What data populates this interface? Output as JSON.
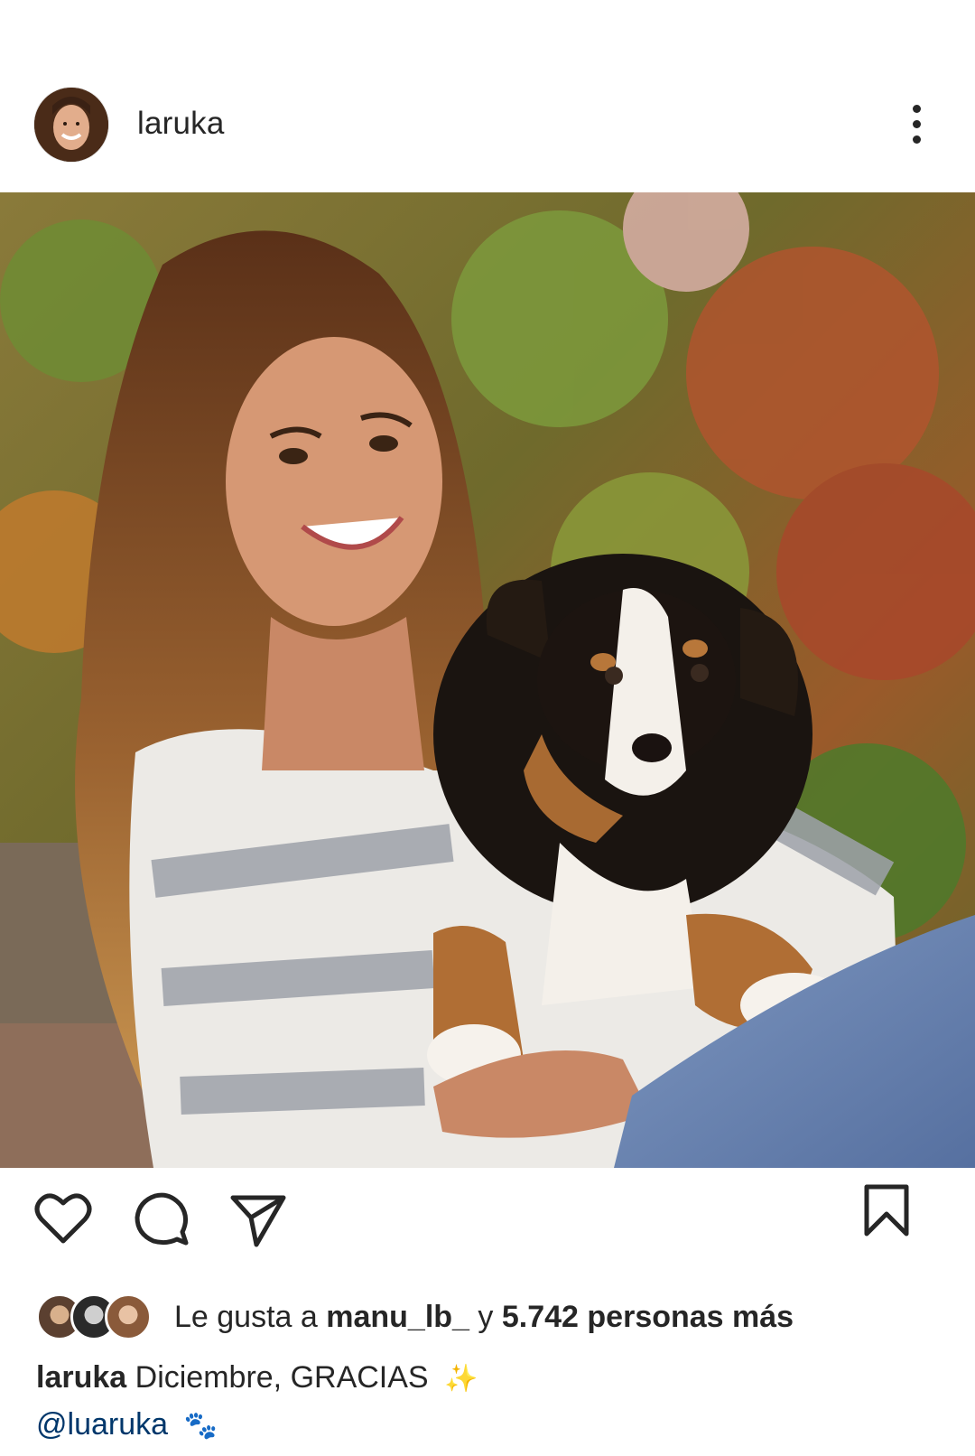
{
  "post": {
    "username": "laruka",
    "more_icon": "more-vertical-icon"
  },
  "actions": {
    "like_icon": "heart-icon",
    "comment_icon": "comment-icon",
    "share_icon": "send-icon",
    "save_icon": "bookmark-icon"
  },
  "likes": {
    "prefix": "Le gusta a",
    "first_user": "manu_lb_",
    "connector": "y",
    "others": "5.742 personas más"
  },
  "caption": {
    "username": "laruka",
    "text": "Diciembre, GRACIAS",
    "sparkles": "✨",
    "mention": "@luaruka",
    "paw": "🐾"
  },
  "colors": {
    "text": "#262626",
    "mention": "#00376b",
    "background": "#ffffff"
  }
}
